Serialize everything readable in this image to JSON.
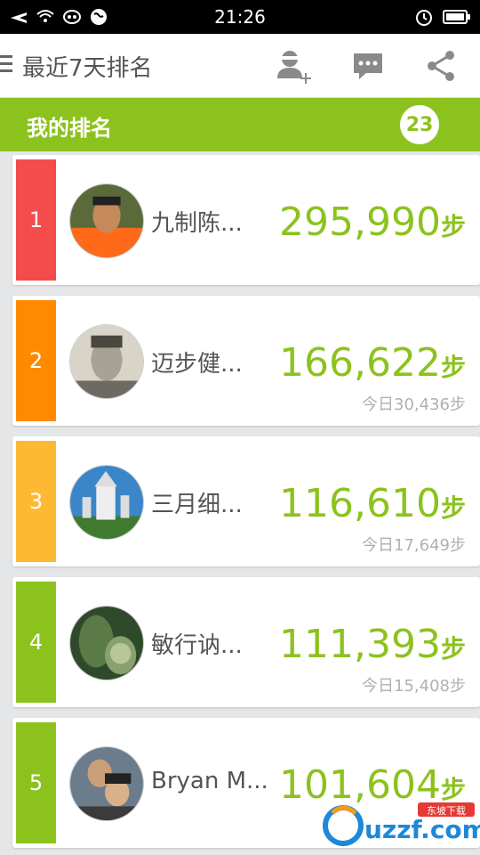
{
  "status_bar": {
    "time": "21:26"
  },
  "toolbar": {
    "title": "最近7天排名"
  },
  "my_rank": {
    "label": "我的排名",
    "value": "23"
  },
  "colors": {
    "green": "#8cc21e",
    "red": "#f44b4b",
    "orange": "#ff8a00",
    "yellow": "#fdb933"
  },
  "ranking": [
    {
      "rank": "1",
      "name": "九制陈...",
      "steps": "295,990",
      "unit": "步",
      "today": ""
    },
    {
      "rank": "2",
      "name": "迈步健...",
      "steps": "166,622",
      "unit": "步",
      "today": "今日30,436步"
    },
    {
      "rank": "3",
      "name": "三月细...",
      "steps": "116,610",
      "unit": "步",
      "today": "今日17,649步"
    },
    {
      "rank": "4",
      "name": "敏行讷...",
      "steps": "111,393",
      "unit": "步",
      "today": "今日15,408步"
    },
    {
      "rank": "5",
      "name": "Bryan M...",
      "steps": "101,604",
      "unit": "步",
      "today": ""
    }
  ],
  "watermark": {
    "brand": "uzzf.com",
    "tag": "东坡下载"
  }
}
